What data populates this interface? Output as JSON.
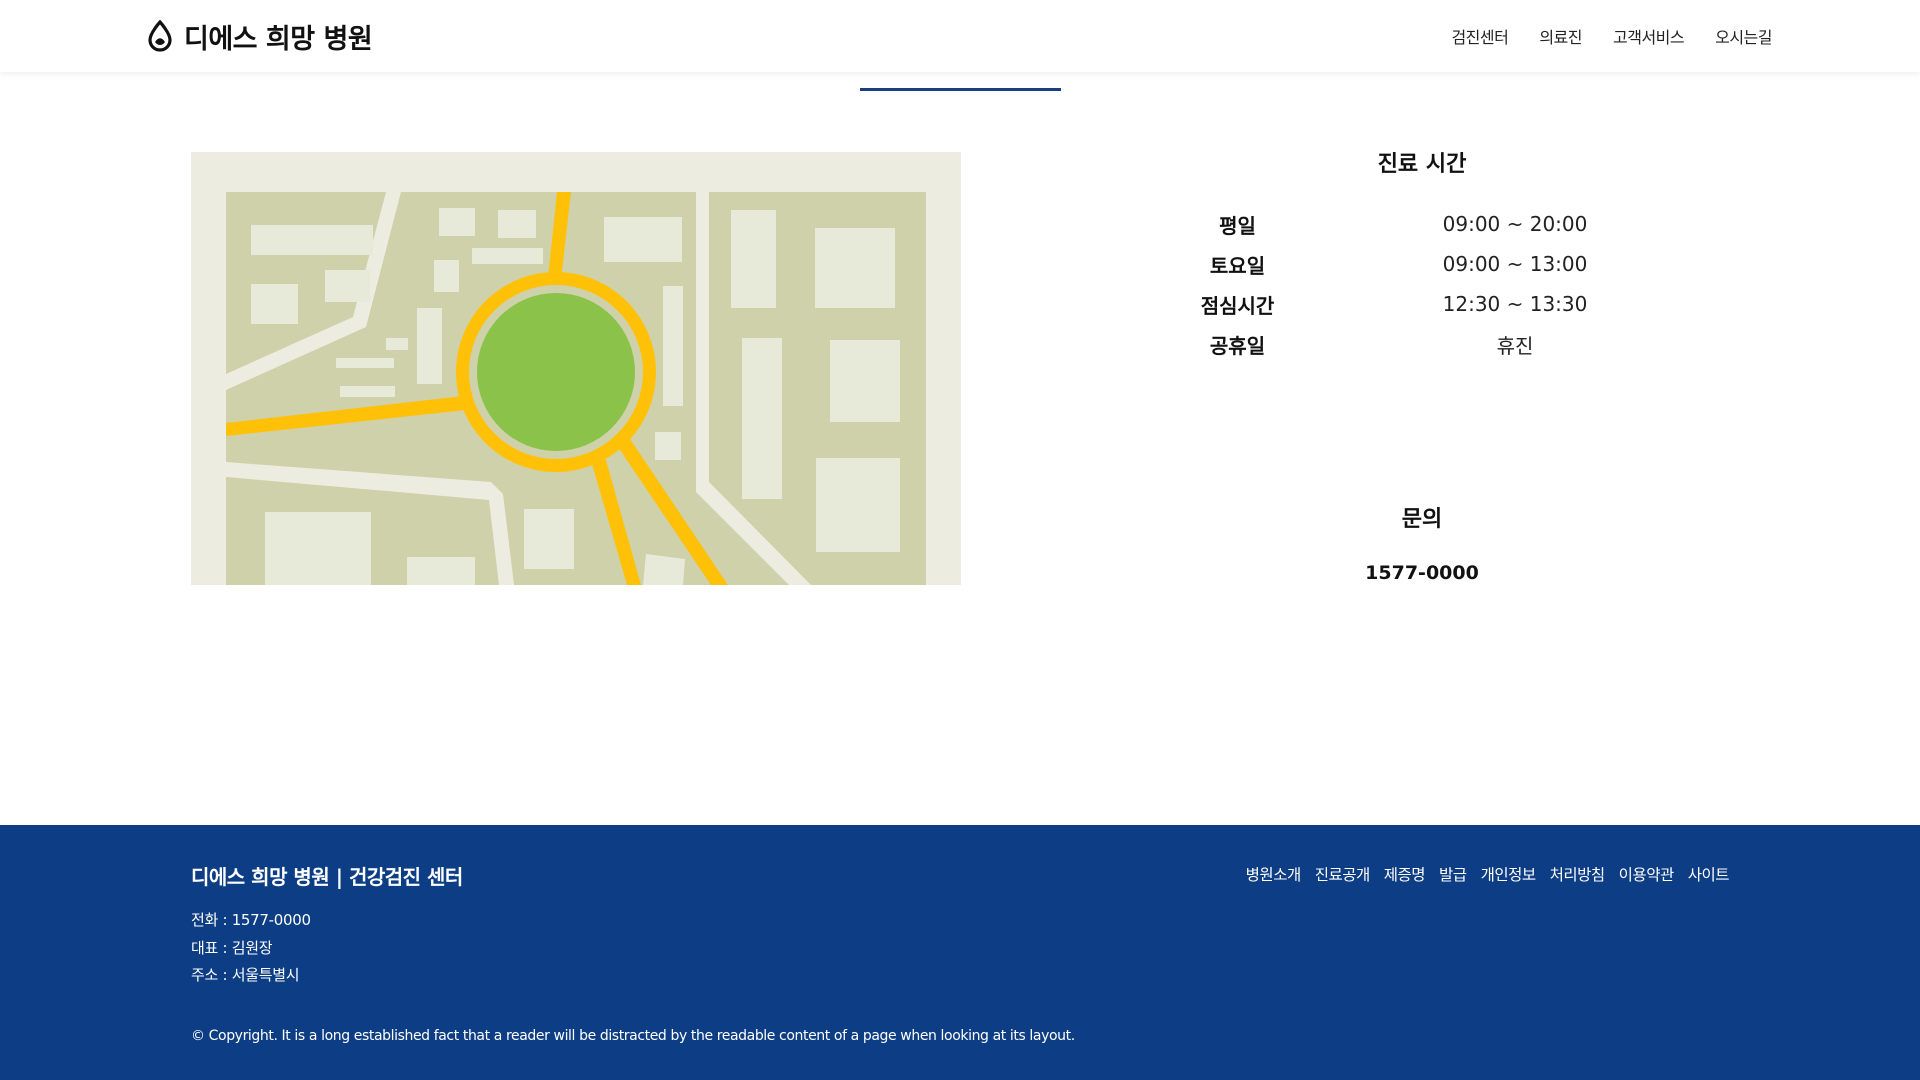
{
  "brand": {
    "name": "디에스 희망 병원",
    "icon": "drop-logo-icon"
  },
  "nav": {
    "items": [
      {
        "label": "검진센터"
      },
      {
        "label": "의료진"
      },
      {
        "label": "고객서비스"
      },
      {
        "label": "오시는길"
      }
    ],
    "active_index": 3
  },
  "map": {
    "icon": "location-map-illustration"
  },
  "hours": {
    "title": "진료 시간",
    "rows": [
      {
        "day": "평일",
        "time": "09:00 ~ 20:00"
      },
      {
        "day": "토요일",
        "time": "09:00 ~ 13:00"
      },
      {
        "day": "점심시간",
        "time": "12:30 ~ 13:30"
      },
      {
        "day": "공휴일",
        "time": "휴진"
      }
    ]
  },
  "contact": {
    "title": "문의",
    "phone": "1577-0000"
  },
  "footer": {
    "title": "디에스 희망 병원 | 건강검진 센터",
    "info": [
      "전화 : 1577-0000",
      "대표 : 김원장",
      "주소 : 서울특별시"
    ],
    "links": [
      {
        "label": "병원소개"
      },
      {
        "label": "진료공개"
      },
      {
        "label": "제증명"
      },
      {
        "label": "발급"
      },
      {
        "label": "개인정보"
      },
      {
        "label": "처리방침"
      },
      {
        "label": "이용약관"
      },
      {
        "label": "사이트"
      }
    ],
    "copyright": "© Copyright. It is a long established fact that a reader will be distracted by the readable content of a page when looking at its layout."
  },
  "colors": {
    "footer_bg": "#0d3d84",
    "active_bar": "#1a3f80",
    "map_road": "#ffc107",
    "map_park": "#8bc34a",
    "map_land": "#cfd1aa",
    "map_block": "#e8ead9"
  }
}
